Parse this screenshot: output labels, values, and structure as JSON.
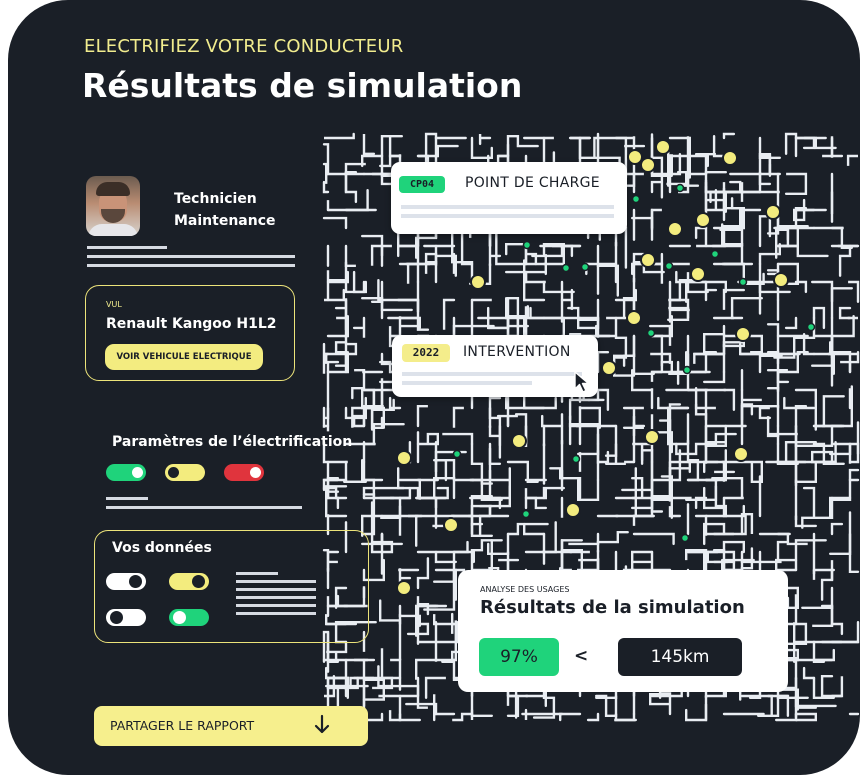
{
  "header": {
    "kicker": "ELECTRIFIEZ VOTRE CONDUCTEUR",
    "title": "Résultats de simulation"
  },
  "profile": {
    "role_line1": "Technicien",
    "role_line2": "Maintenance"
  },
  "vehicle": {
    "category": "VUL",
    "model": "Renault Kangoo H1L2",
    "button_label": "VOIR VEHICULE ELECTRIQUE"
  },
  "parameters": {
    "title": "Paramètres de l’électrification",
    "toggles": [
      {
        "color": "#1fd37b",
        "state": "on"
      },
      {
        "color": "#f3ec7e",
        "state": "off"
      },
      {
        "color": "#e0343d",
        "state": "on"
      }
    ]
  },
  "data_section": {
    "title": "Vos données",
    "toggles": [
      {
        "color": "#ffffff",
        "state": "on"
      },
      {
        "color": "#f3ec7e",
        "state": "on"
      },
      {
        "color": "#ffffff",
        "state": "off"
      },
      {
        "color": "#1fd37b",
        "state": "off"
      }
    ]
  },
  "map_cards": {
    "charge_point": {
      "tag": "CP04",
      "label": "POINT DE CHARGE"
    },
    "intervention": {
      "tag": "2022",
      "label": "INTERVENTION"
    }
  },
  "results": {
    "kicker": "ANALYSE DES USAGES",
    "title": "Résultats de la simulation",
    "percent": "97%",
    "comparator": "<",
    "distance": "145km"
  },
  "share": {
    "label": "PARTAGER LE RAPPORT",
    "icon": "arrow-down-icon"
  },
  "colors": {
    "background": "#1a1f27",
    "accent_yellow": "#f3ec7e",
    "accent_green": "#1fd37b",
    "accent_red": "#e0343d"
  }
}
